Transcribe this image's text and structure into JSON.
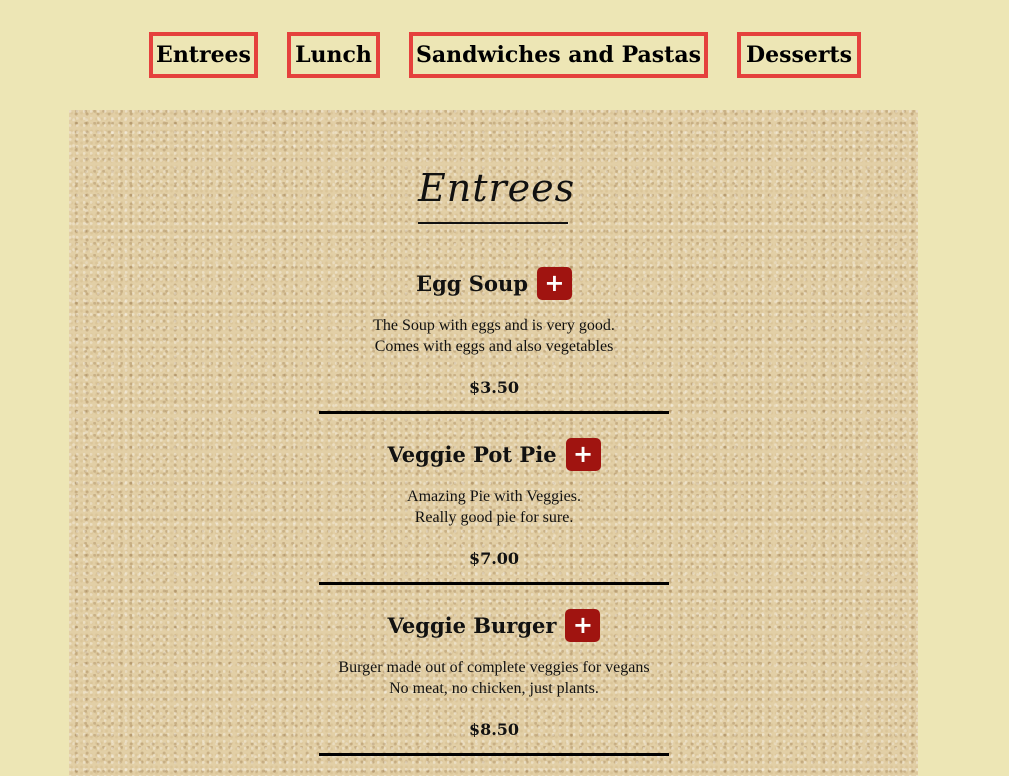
{
  "nav": {
    "tabs": [
      {
        "label": "Entrees"
      },
      {
        "label": "Lunch"
      },
      {
        "label": "Sandwiches and Pastas"
      },
      {
        "label": "Desserts"
      }
    ]
  },
  "section": {
    "title": "Entrees"
  },
  "items": [
    {
      "name": "Egg Soup",
      "description": [
        "The Soup with eggs and is very good.",
        "Comes with eggs and also vegetables"
      ],
      "price": "$3.50",
      "add_label": "+"
    },
    {
      "name": "Veggie Pot Pie",
      "description": [
        "Amazing Pie with Veggies.",
        "Really good pie for sure."
      ],
      "price": "$7.00",
      "add_label": "+"
    },
    {
      "name": "Veggie Burger",
      "description": [
        "Burger made out of complete veggies for vegans",
        "No meat, no chicken, just plants."
      ],
      "price": "$8.50",
      "add_label": "+"
    }
  ],
  "colors": {
    "page_background": "#ede6b5",
    "tab_border": "#e5413d",
    "add_button": "#a01410"
  }
}
